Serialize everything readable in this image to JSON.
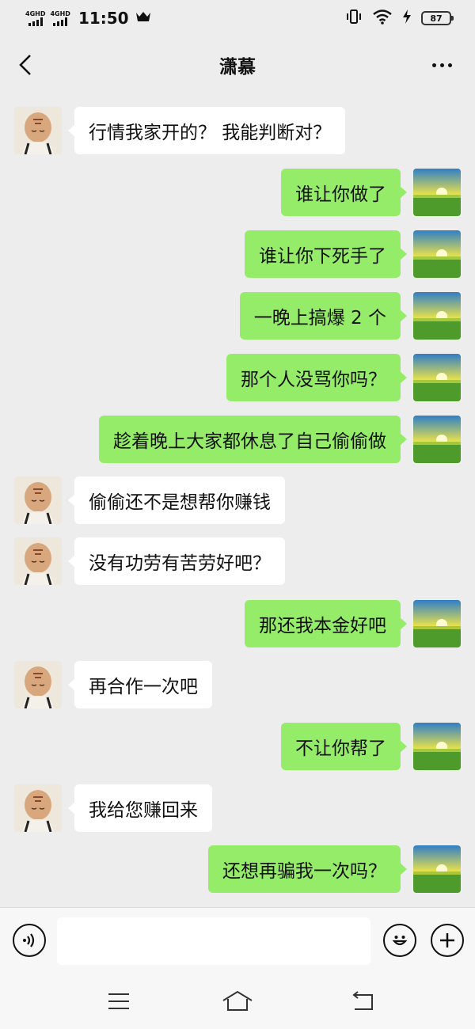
{
  "status": {
    "network1": "4GHD",
    "network2": "4GHD",
    "time": "11:50",
    "battery": "87"
  },
  "header": {
    "title": "潇慕"
  },
  "messages": [
    {
      "side": "left",
      "text": "行情我家开的？ 我能判断对？"
    },
    {
      "side": "right",
      "text": "谁让你做了"
    },
    {
      "side": "right",
      "text": "谁让你下死手了"
    },
    {
      "side": "right",
      "text": "一晚上搞爆 2 个"
    },
    {
      "side": "right",
      "text": "那个人没骂你吗？"
    },
    {
      "side": "right",
      "text": "趁着晚上大家都休息了自己偷偷做"
    },
    {
      "side": "left",
      "text": "偷偷还不是想帮你赚钱"
    },
    {
      "side": "left",
      "text": "没有功劳有苦劳好吧？"
    },
    {
      "side": "right",
      "text": "那还我本金好吧"
    },
    {
      "side": "left",
      "text": "再合作一次吧"
    },
    {
      "side": "right",
      "text": "不让你帮了"
    },
    {
      "side": "left",
      "text": "我给您赚回来"
    },
    {
      "side": "right",
      "text": "还想再骗我一次吗？"
    }
  ],
  "input": {
    "value": "",
    "placeholder": ""
  },
  "icons": {
    "back": "chevron-left-icon",
    "more": "more-dots-icon",
    "voice": "voice-icon",
    "emoji": "emoji-icon",
    "plus": "plus-icon",
    "nav_menu": "menu-icon",
    "nav_home": "home-icon",
    "nav_back": "back-icon"
  },
  "colors": {
    "background": "#ededed",
    "sent_bubble": "#95ec69",
    "received_bubble": "#ffffff"
  }
}
